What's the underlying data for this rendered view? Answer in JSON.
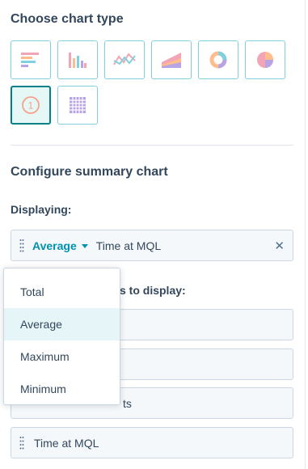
{
  "choose_chart": {
    "title": "Choose chart type",
    "types": [
      {
        "icon": "horizontal-bar-chart-icon",
        "selected": false
      },
      {
        "icon": "vertical-bar-chart-icon",
        "selected": false
      },
      {
        "icon": "line-chart-icon",
        "selected": false
      },
      {
        "icon": "area-chart-icon",
        "selected": false
      },
      {
        "icon": "donut-chart-icon",
        "selected": false
      },
      {
        "icon": "pie-chart-icon",
        "selected": false
      },
      {
        "icon": "summary-chart-icon",
        "selected": true
      },
      {
        "icon": "table-chart-icon",
        "selected": false
      }
    ]
  },
  "configure": {
    "title": "Configure summary chart",
    "displaying_label": "Displaying:",
    "displaying": {
      "aggregation": "Average",
      "property": "Time at MQL"
    },
    "properties_label_partial": "s to display:",
    "properties": [
      {
        "text": ""
      },
      {
        "text": ""
      },
      {
        "text": "ts"
      },
      {
        "text": "Time at MQL"
      }
    ]
  },
  "aggregation_menu": {
    "options": [
      "Total",
      "Average",
      "Maximum",
      "Minimum"
    ],
    "highlighted": "Average"
  },
  "colors": {
    "accent": "#00818a",
    "link": "#0091ae",
    "text": "#33475b",
    "field_bg": "#f5f8fa"
  }
}
